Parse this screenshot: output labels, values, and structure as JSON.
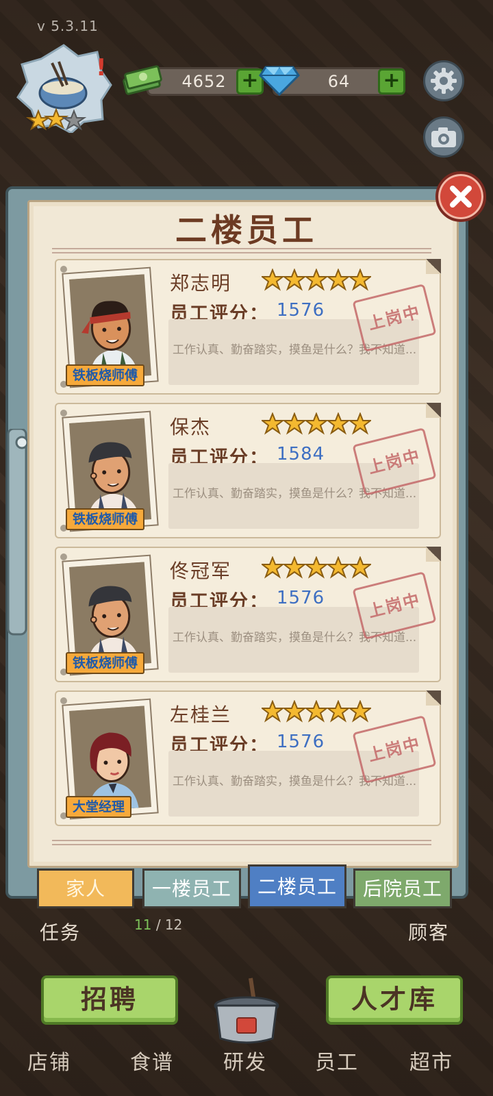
{
  "hud": {
    "version": "v 5.3.11",
    "cash": "4652",
    "gems": "64",
    "badge_stars": 2,
    "badge_max_stars": 3
  },
  "panel": {
    "title": "二楼员工"
  },
  "staff": [
    {
      "name": "郑志明",
      "stars": 5,
      "score_label": "员工评分：",
      "score": "1576",
      "description": "工作认真、勤奋踏实，摸鱼是什么？我不知道...",
      "status": "上岗中",
      "job": "铁板烧师傅"
    },
    {
      "name": "保杰",
      "stars": 5,
      "score_label": "员工评分：",
      "score": "1584",
      "description": "工作认真、勤奋踏实，摸鱼是什么？我不知道...",
      "status": "上岗中",
      "job": "铁板烧师傅"
    },
    {
      "name": "佟冠军",
      "stars": 5,
      "score_label": "员工评分：",
      "score": "1576",
      "description": "工作认真、勤奋踏实，摸鱼是什么？我不知道...",
      "status": "上岗中",
      "job": "铁板烧师傅"
    },
    {
      "name": "左桂兰",
      "stars": 5,
      "score_label": "员工评分：",
      "score": "1576",
      "description": "工作认真、勤奋踏实，摸鱼是什么？我不知道...",
      "status": "上岗中",
      "job": "大堂经理"
    }
  ],
  "tabs": {
    "family": "家人",
    "floor1": "一楼员工",
    "floor2": "二楼员工",
    "backyard": "后院员工",
    "active": "floor2"
  },
  "background": {
    "task_label": "任务",
    "customer_label": "顾客",
    "progress_current": "11",
    "progress_total": "12"
  },
  "actions": {
    "recruit": "招聘",
    "talent_pool": "人才库"
  },
  "nav": {
    "shop": "店铺",
    "recipes": "食谱",
    "research": "研发",
    "staff": "员工",
    "market": "超市"
  },
  "colors": {
    "title": "#6d3b23",
    "score_value": "#3e6fc2",
    "stamp": "#c46a6a",
    "star": "#f4b930",
    "tab_active": "#4f7fc4"
  }
}
